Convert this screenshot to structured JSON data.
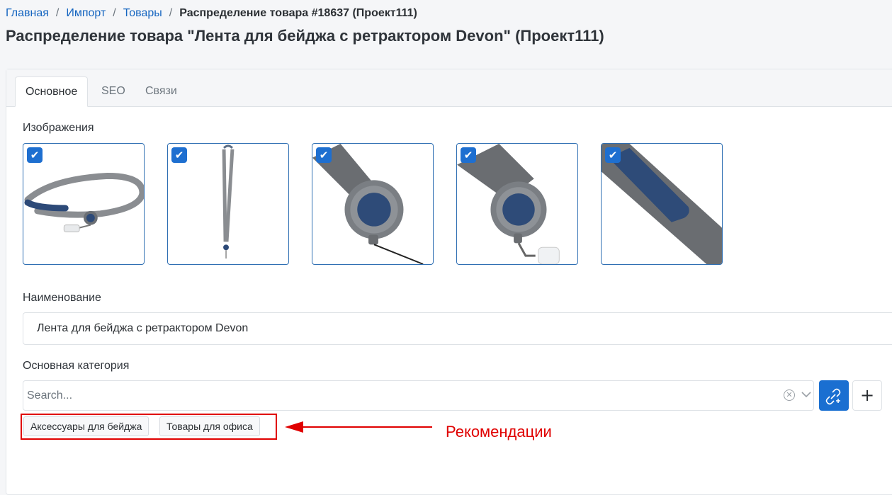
{
  "breadcrumb": {
    "items": [
      "Главная",
      "Импорт",
      "Товары"
    ],
    "separator": "/",
    "current": "Распределение товара #18637 (Проект111)"
  },
  "page_title": "Распределение товара \"Лента для бейджа с ретрактором Devon\" (Проект111)",
  "tabs": [
    {
      "label": "Основное",
      "active": true
    },
    {
      "label": "SEO",
      "active": false
    },
    {
      "label": "Связи",
      "active": false
    }
  ],
  "images": {
    "label": "Изображения",
    "items": [
      {
        "checked": true,
        "depicts": "lanyard-full"
      },
      {
        "checked": true,
        "depicts": "lanyard-vertical"
      },
      {
        "checked": true,
        "depicts": "retractor-closeup"
      },
      {
        "checked": true,
        "depicts": "retractor-clip-closeup"
      },
      {
        "checked": true,
        "depicts": "strap-closeup"
      }
    ]
  },
  "name_field": {
    "label": "Наименование",
    "value": "Лента для бейджа с ретрактором Devon"
  },
  "category_field": {
    "label": "Основная категория",
    "placeholder": "Search...",
    "link_button_icon": "link-plus-icon",
    "add_button_label": "+"
  },
  "recommendations": [
    "Аксессуары для бейджа",
    "Товары для офиса"
  ],
  "annotation": {
    "text": "Рекомендации",
    "color": "#e00000"
  },
  "colors": {
    "accent": "#1a6fd1",
    "link": "#1565c0",
    "annotation": "#e00000"
  }
}
